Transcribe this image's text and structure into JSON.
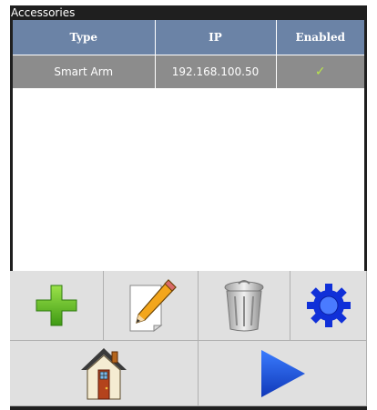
{
  "window": {
    "title": "Accessories"
  },
  "table": {
    "headers": [
      "Type",
      "IP",
      "Enabled"
    ],
    "rows": [
      {
        "type": "Smart Arm",
        "ip": "192.168.100.50",
        "enabled": "✓"
      }
    ]
  },
  "toolbar": {
    "icons": [
      "add-icon",
      "edit-icon",
      "trash-icon",
      "settings-icon",
      "home-icon",
      "play-icon"
    ]
  }
}
